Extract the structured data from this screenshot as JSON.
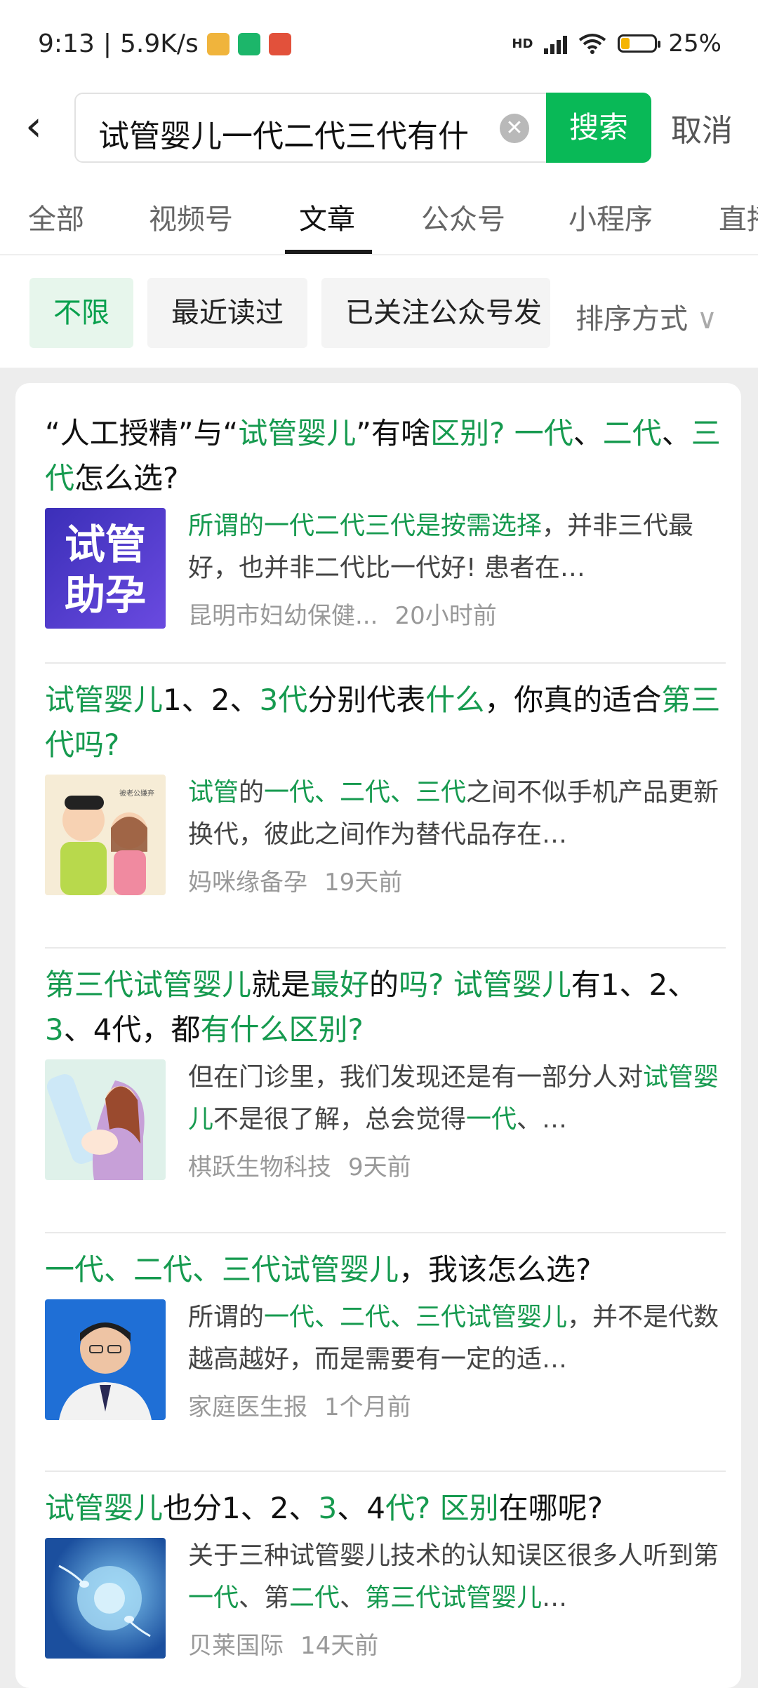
{
  "status": {
    "time": "9:13",
    "speed": "5.9K/s",
    "network_label": "HD",
    "battery": "25%",
    "battery_level": 0.25
  },
  "search": {
    "query": "试管婴儿一代二代三代有什",
    "button": "搜索",
    "cancel": "取消"
  },
  "tabs": [
    "全部",
    "视频号",
    "文章",
    "公众号",
    "小程序",
    "直播"
  ],
  "active_tab": "文章",
  "filters": [
    "不限",
    "最近读过",
    "已关注公众号发"
  ],
  "sort_label": "排序方式",
  "results": [
    {
      "title_parts": [
        "“人工授精”与“",
        "试管婴儿",
        "”有啥",
        "区别? 一代",
        "、",
        "二代",
        "、",
        "三代",
        "怎么选?"
      ],
      "snippet_parts": [
        "所谓的一代二代三代是按需选择",
        "，并非三代最好，也并非二代比一代好! 患者在…"
      ],
      "thumb_text": "试管\n助孕",
      "source": "昆明市妇幼保健...",
      "time": "20小时前"
    },
    {
      "title_parts": [
        "试管婴儿",
        "1、2、",
        "3代",
        "分别代表",
        "什么",
        "，你真的适合",
        "第三代吗?"
      ],
      "snippet_parts": [
        "试管",
        "的",
        "一代、二代、三代",
        "之间不似手机产品更新换代，彼此之间作为替代品存在…"
      ],
      "thumb_caption": "被老公嫌弃",
      "source": "妈咪缘备孕",
      "time": "19天前"
    },
    {
      "title_parts": [
        "第三代试管婴儿",
        "就是",
        "最好",
        "的",
        "吗? 试管婴儿",
        "有1、2、",
        "3",
        "、4代，都",
        "有什么区别?"
      ],
      "snippet_parts": [
        "但在门诊里，我们发现还是有一部分人对",
        "试管婴儿",
        "不是很了解，总会觉得",
        "一代",
        "、…"
      ],
      "source": "棋跃生物科技",
      "time": "9天前"
    },
    {
      "title_parts": [
        "一代、二代、三代试管婴儿",
        "，我该怎么选?"
      ],
      "snippet_parts": [
        "所谓的",
        "一代、二代、三代试管婴儿",
        "，并不是代数越高越好，而是需要有一定的适…"
      ],
      "source": "家庭医生报",
      "time": "1个月前"
    },
    {
      "title_parts": [
        "试管婴儿",
        "也分1、2、",
        "3",
        "、4",
        "代? 区别",
        "在哪呢?"
      ],
      "snippet_parts": [
        "关于三种试管婴儿技术的认知误区很多人听到第",
        "一代",
        "、第",
        "二代",
        "、",
        "第三代试管婴儿",
        "…"
      ],
      "source": "贝莱国际",
      "time": "14天前"
    }
  ]
}
